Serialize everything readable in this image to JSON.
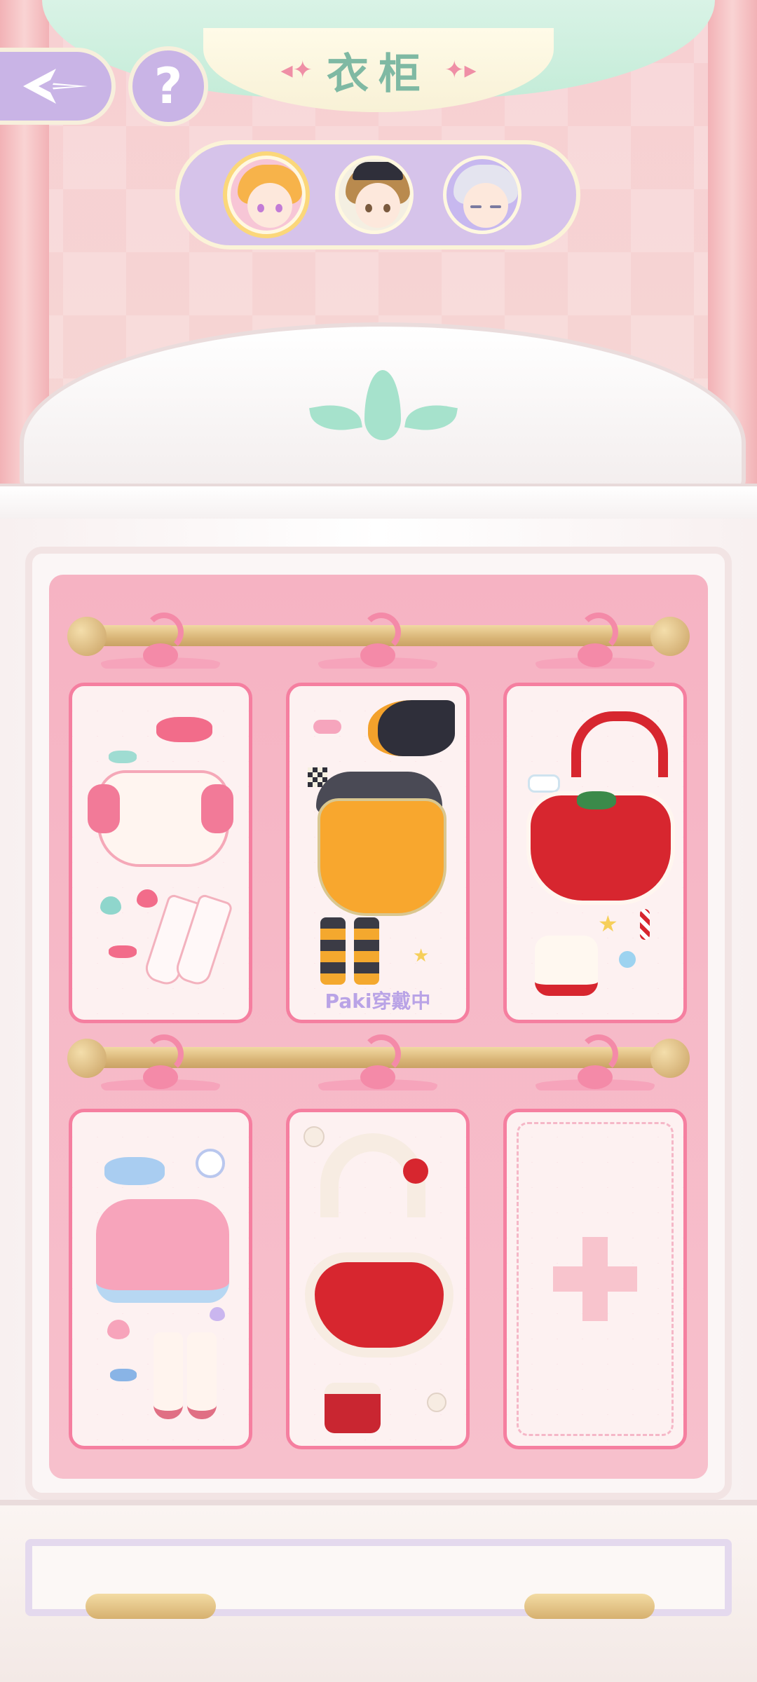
{
  "header": {
    "title": "衣柜",
    "back_icon": "back-arrow-icon",
    "help_label": "?"
  },
  "characters": [
    {
      "name": "blonde-girl-avatar",
      "selected": true
    },
    {
      "name": "brown-hair-girl-avatar",
      "selected": false
    },
    {
      "name": "silver-hair-girl-avatar",
      "selected": false
    }
  ],
  "wardrobe": {
    "slots": [
      {
        "outfit": "pink-white-dress-outfit",
        "status": ""
      },
      {
        "outfit": "witch-halloween-outfit",
        "status": "Paki穿戴中"
      },
      {
        "outfit": "christmas-red-dress-outfit",
        "status": ""
      },
      {
        "outfit": "pink-sweater-outfit",
        "status": ""
      },
      {
        "outfit": "red-lucky-dress-outfit",
        "status": ""
      },
      {
        "outfit": "empty-slot",
        "status": ""
      }
    ]
  },
  "colors": {
    "accent_purple": "#c9b4e6",
    "card_border": "#f57fa0",
    "title_green": "#7fb9a3",
    "wearing_label": "#b9a3e6"
  }
}
